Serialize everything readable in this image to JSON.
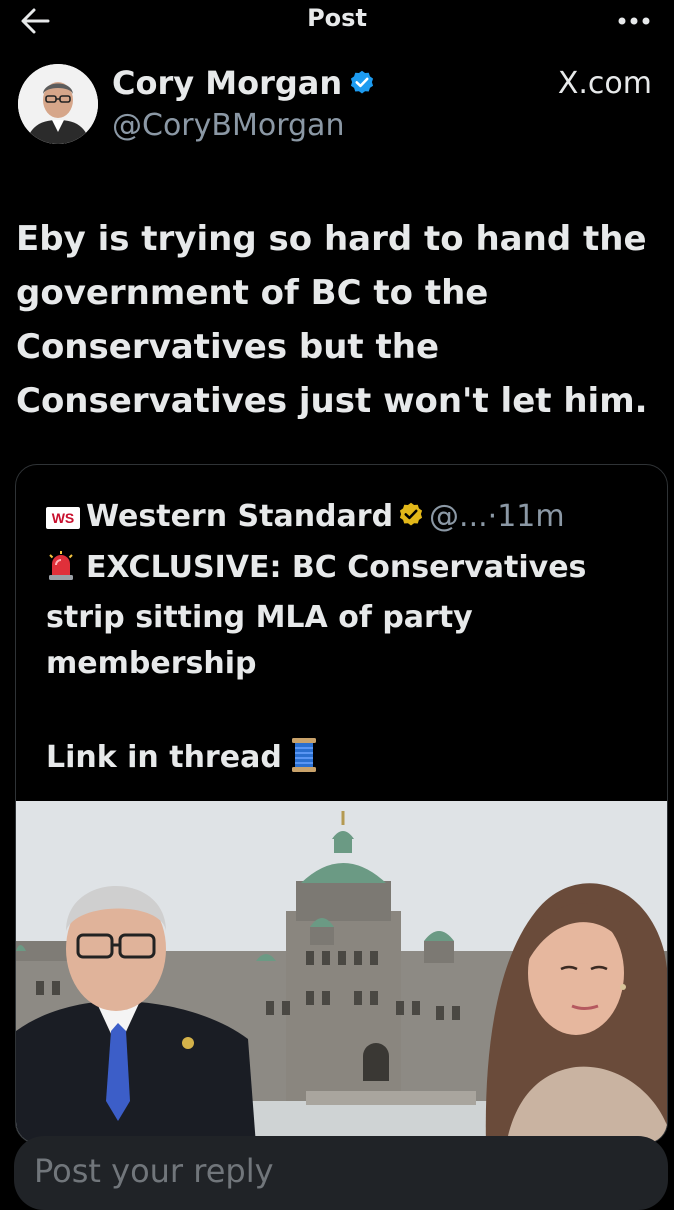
{
  "header": {
    "title": "Post"
  },
  "post": {
    "author_name": "Cory Morgan",
    "author_handle": "@CoryBMorgan",
    "source": "X.com",
    "text_lines": [
      "Eby is trying so hard to hand the",
      "government of BC to the",
      "Conservatives but the",
      "Conservatives just won't let him."
    ]
  },
  "quoted_post": {
    "logo_text": "WS",
    "author_name": "Western Standard",
    "author_handle": "@...",
    "separator": "·",
    "time": "11m",
    "text_lines": [
      "EXCLUSIVE: BC Conservatives",
      "strip sitting MLA of party",
      "membership"
    ],
    "link_text": "Link in thread"
  },
  "reply": {
    "placeholder": "Post your reply"
  },
  "colors": {
    "background": "#000000",
    "text": "#e7e9ea",
    "muted": "#8b98a5",
    "verified_blue": "#1d9bf0",
    "verified_gold": "#e2b719",
    "reply_bar": "#202327"
  },
  "icons": [
    "back-arrow-icon",
    "more-icon",
    "verified-icon",
    "gold-verified-icon",
    "siren-icon",
    "thread-spool-icon"
  ]
}
